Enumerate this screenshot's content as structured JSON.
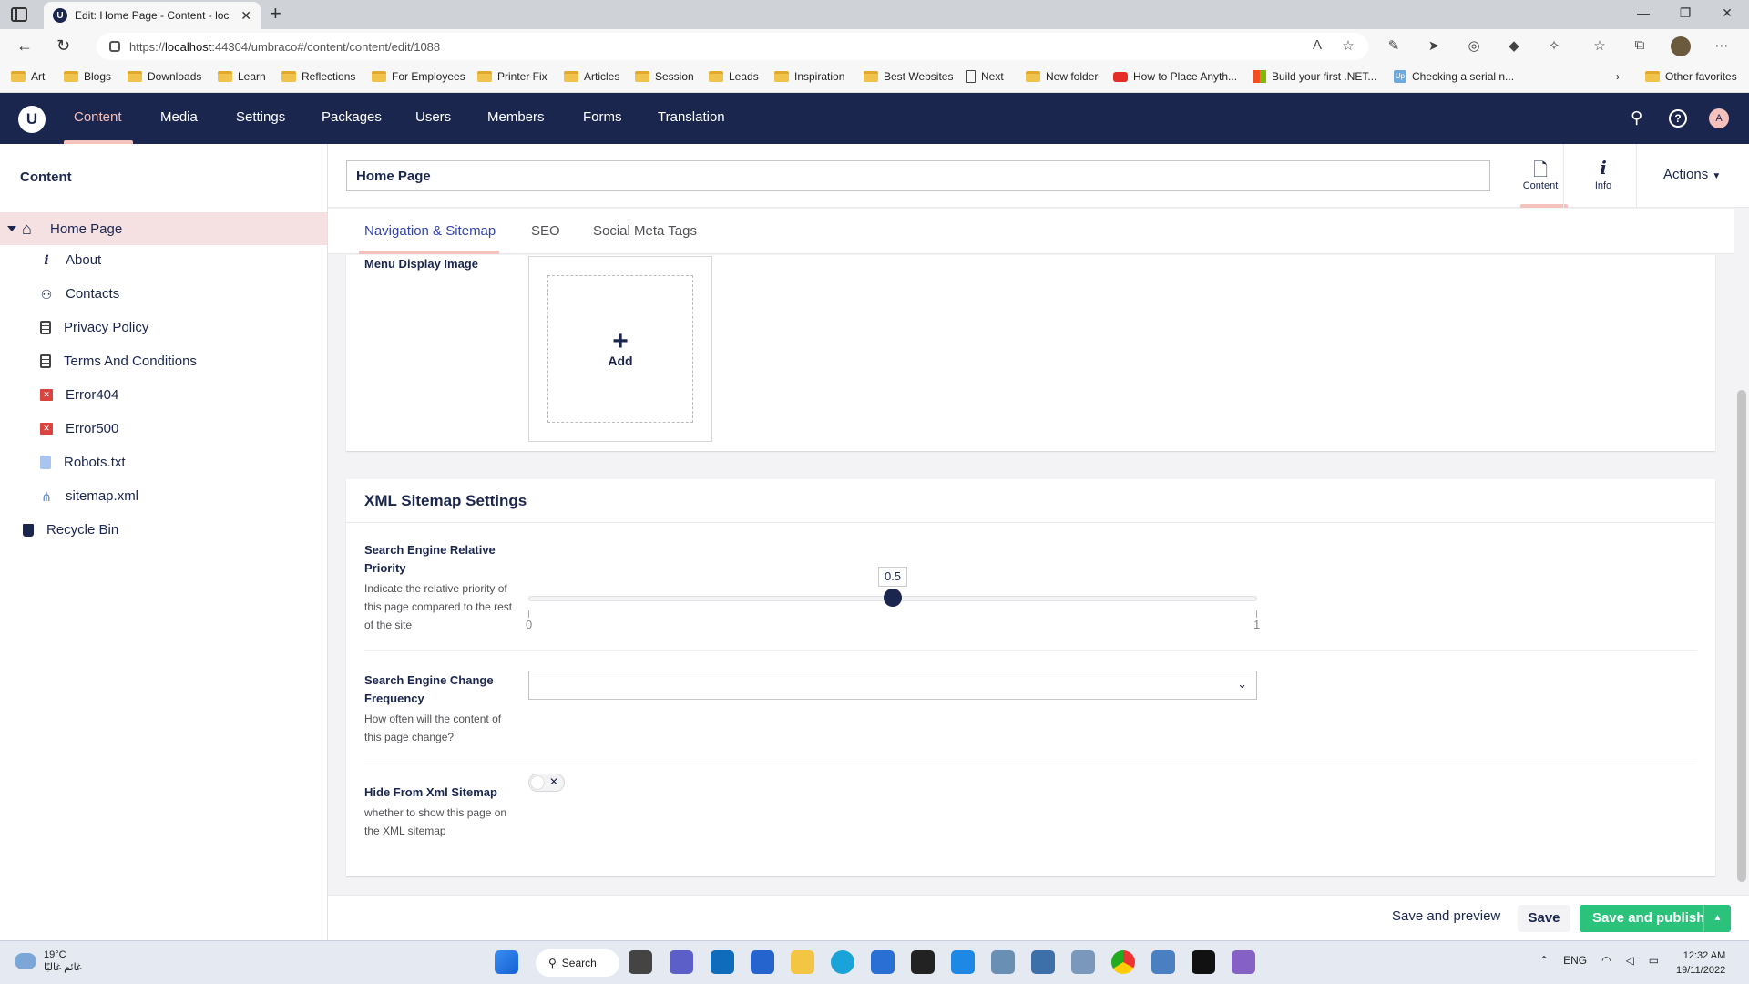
{
  "browser": {
    "tab_title": "Edit: Home Page - Content - loc",
    "url_prefix": "https://",
    "url_host": "localhost",
    "url_rest": ":44304/umbraco#/content/content/edit/1088",
    "bookmarks": [
      "Art",
      "Blogs",
      "Downloads",
      "Learn",
      "Reflections",
      "For Employees",
      "Printer Fix",
      "Articles",
      "Session",
      "Leads",
      "Inspiration",
      "Best Websites",
      "Next",
      "New folder",
      "How to Place Anyth...",
      "Build your first .NET...",
      "Checking a serial n...",
      "Other favorites"
    ]
  },
  "header": {
    "sections": [
      "Content",
      "Media",
      "Settings",
      "Packages",
      "Users",
      "Members",
      "Forms",
      "Translation"
    ],
    "user_initial": "A"
  },
  "tree": {
    "title": "Content",
    "root": "Home Page",
    "items": [
      "About",
      "Contacts",
      "Privacy Policy",
      "Terms And Conditions",
      "Error404",
      "Error500",
      "Robots.txt",
      "sitemap.xml"
    ],
    "recycle_bin": "Recycle Bin"
  },
  "editor": {
    "name_value": "Home Page",
    "apps": {
      "content": "Content",
      "info": "Info"
    },
    "actions": "Actions",
    "tabs": [
      "Navigation & Sitemap",
      "SEO",
      "Social Meta Tags"
    ],
    "menu_image": {
      "label": "Menu Display Image",
      "add_label": "Add"
    },
    "xml_title": "XML Sitemap Settings",
    "priority": {
      "label": "Search Engine Relative Priority",
      "description": "Indicate the relative priority of this page compared to the rest of the site",
      "value": "0.5",
      "value_fraction": 0.5,
      "min": "0",
      "max": "1"
    },
    "frequency": {
      "label": "Search Engine Change Frequency",
      "description": "How often will the content of this page change?",
      "selected": ""
    },
    "hide": {
      "label": "Hide From Xml Sitemap",
      "description": "whether to show this page on the XML sitemap",
      "toggle_mark": "✕"
    }
  },
  "footer": {
    "preview": "Save and preview",
    "save": "Save",
    "publish": "Save and publish"
  },
  "taskbar": {
    "temp": "19°C",
    "weather_desc": "غائم غالبًا",
    "search": "Search",
    "lang": "ENG",
    "time": "12:32 AM",
    "date": "19/11/2022"
  },
  "colors": {
    "brand_navy": "#1b264f",
    "accent_pink": "#f5c1bc",
    "publish_green": "#2bc37c",
    "active_tab_blue": "#3544b1"
  }
}
